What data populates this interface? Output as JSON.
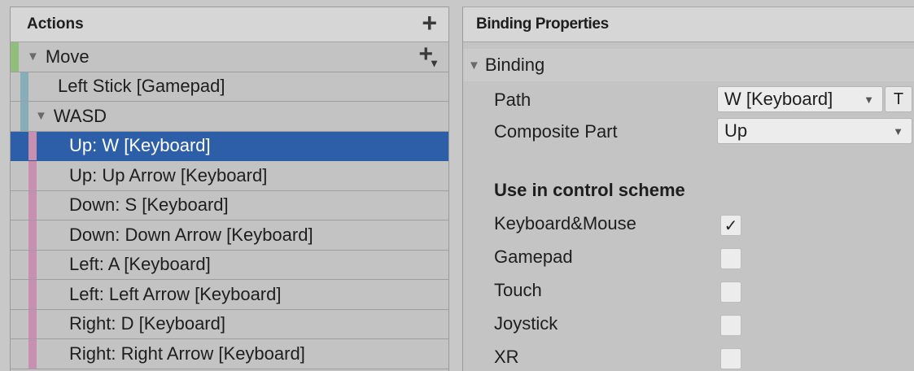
{
  "actions_panel": {
    "title": "Actions",
    "add_icon": "plus-icon"
  },
  "action_map": {
    "name": "Move",
    "add_icon": "plus-dropdown-icon",
    "rows": [
      {
        "label": "Left Stick [Gamepad]",
        "indent": 1
      },
      {
        "label": "WASD",
        "indent": 1,
        "expandable": true
      },
      {
        "label": "Up: W [Keyboard]",
        "indent": 2,
        "selected": true
      },
      {
        "label": "Up: Up Arrow [Keyboard]",
        "indent": 2
      },
      {
        "label": "Down: S [Keyboard]",
        "indent": 2
      },
      {
        "label": "Down: Down Arrow [Keyboard]",
        "indent": 2
      },
      {
        "label": "Left: A [Keyboard]",
        "indent": 2
      },
      {
        "label": "Left: Left Arrow [Keyboard]",
        "indent": 2
      },
      {
        "label": "Right: D [Keyboard]",
        "indent": 2
      },
      {
        "label": "Right: Right Arrow [Keyboard]",
        "indent": 2
      }
    ]
  },
  "binding_properties": {
    "title": "Binding Properties",
    "section": "Binding",
    "path_label": "Path",
    "path_value": "W [Keyboard]",
    "t_button": "T",
    "composite_label": "Composite Part",
    "composite_value": "Up",
    "control_scheme_heading": "Use in control scheme",
    "schemes": [
      {
        "label": "Keyboard&Mouse",
        "checked": true
      },
      {
        "label": "Gamepad",
        "checked": false
      },
      {
        "label": "Touch",
        "checked": false
      },
      {
        "label": "Joystick",
        "checked": false
      },
      {
        "label": "XR",
        "checked": false
      }
    ]
  },
  "colors": {
    "selection": "#2d5fa8",
    "action_map_bar": "#8fbf7a",
    "binding_bar": "#86aeb8",
    "composite_part_bar": "#c98fae"
  }
}
